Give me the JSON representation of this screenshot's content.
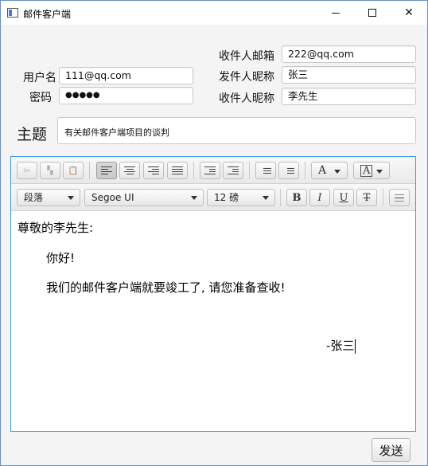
{
  "window": {
    "title": "邮件客户端",
    "minimize": "",
    "maximize": "",
    "close": "✕"
  },
  "form": {
    "username_label": "用户名",
    "username_value": "111@qq.com",
    "password_label": "密码",
    "password_value": "●●●●●",
    "recipient_email_label": "收件人邮箱",
    "recipient_email_value": "222@qq.com",
    "sender_nick_label": "发件人昵称",
    "sender_nick_value": "张三",
    "recipient_nick_label": "收件人昵称",
    "recipient_nick_value": "李先生",
    "subject_label": "主题",
    "subject_value": "有关邮件客户端项目的谈判"
  },
  "toolbar": {
    "cut": "✂",
    "copy": "▚",
    "paste": "📋",
    "paragraph_style": "段落",
    "font_family": "Segoe UI",
    "font_size": "12 磅",
    "bold": "B",
    "italic": "I",
    "underline": "U",
    "strikethrough": "T",
    "text_color": "A",
    "background_color": "A",
    "bullets": "",
    "numbers": "",
    "horizontal_rule": ""
  },
  "editor": {
    "greeting": "尊敬的李先生:",
    "line1": "你好!",
    "line2": "我们的邮件客户端就要竣工了, 请您准备查收!",
    "signature": "-张三"
  },
  "send_button": "发送",
  "icons": [
    "app-icon",
    "cut-icon",
    "copy-icon",
    "paste-icon",
    "align-left-icon",
    "align-center-icon",
    "align-right-icon",
    "align-justify-icon",
    "outdent-icon",
    "indent-icon",
    "bullet-list-icon",
    "numbered-list-icon",
    "text-color-icon",
    "background-color-icon",
    "horizontal-rule-icon"
  ]
}
